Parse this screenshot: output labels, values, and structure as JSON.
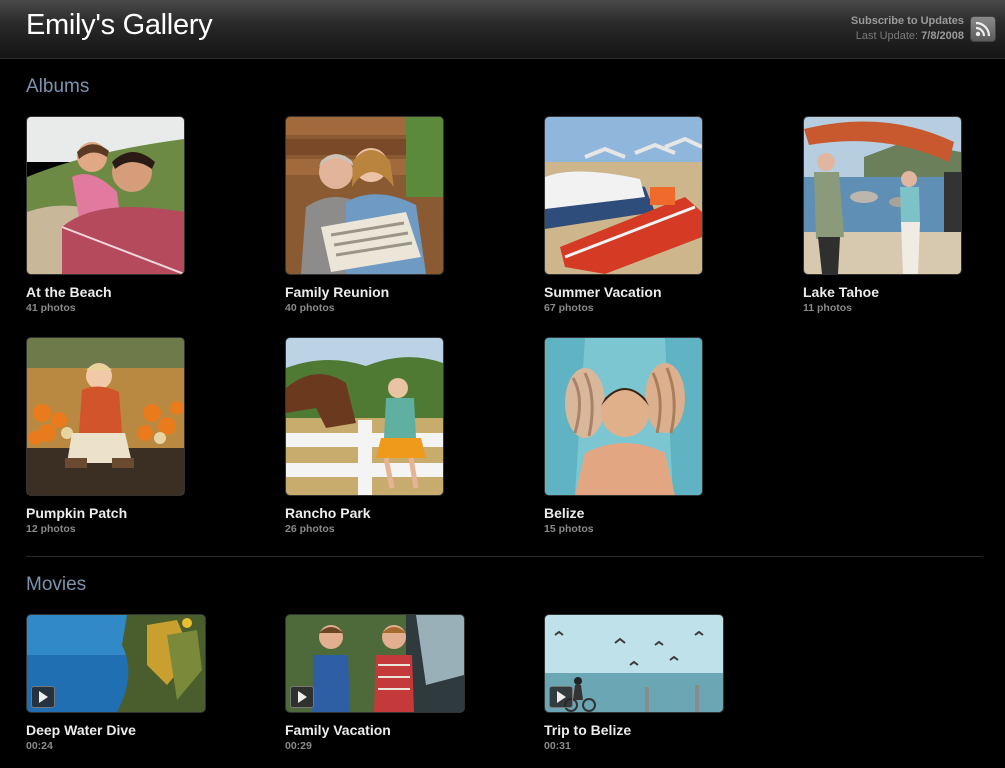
{
  "header": {
    "title": "Emily's Gallery",
    "subscribe_label": "Subscribe to Updates",
    "last_update_label": "Last Update:",
    "last_update_date": "7/8/2008"
  },
  "albums_heading": "Albums",
  "albums": [
    {
      "title": "At the Beach",
      "count": "41 photos"
    },
    {
      "title": "Family Reunion",
      "count": "40 photos"
    },
    {
      "title": "Summer Vacation",
      "count": "67 photos"
    },
    {
      "title": "Lake Tahoe",
      "count": "11 photos"
    },
    {
      "title": "Pumpkin Patch",
      "count": "12 photos"
    },
    {
      "title": "Rancho Park",
      "count": "26 photos"
    },
    {
      "title": "Belize",
      "count": "15 photos"
    }
  ],
  "movies_heading": "Movies",
  "movies": [
    {
      "title": "Deep Water Dive",
      "duration": "00:24"
    },
    {
      "title": "Family Vacation",
      "duration": "00:29"
    },
    {
      "title": "Trip to Belize",
      "duration": "00:31"
    }
  ]
}
